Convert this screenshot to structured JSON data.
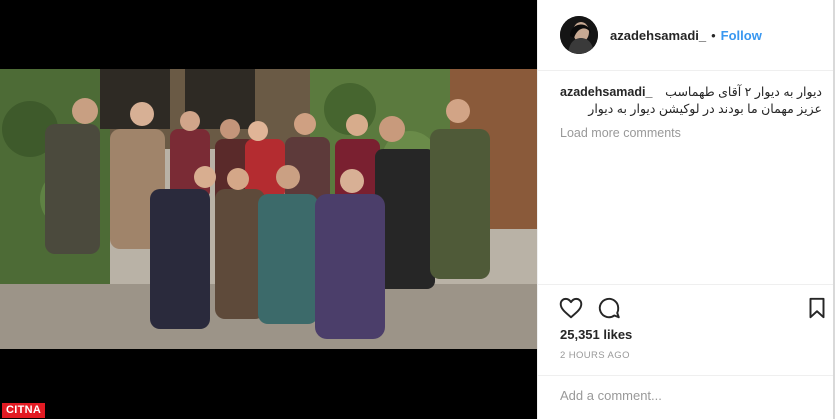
{
  "header": {
    "username": "azadehsamadi_",
    "separator": "•",
    "follow_label": "Follow",
    "avatar_icon": "profile-avatar"
  },
  "caption": {
    "username": "azadehsamadi_",
    "line1": "دیوار به دیوار ۲ آقای طهماسب",
    "line2": "عزیز مهمان ما بودند در لوکیشن دیوار به دیوار"
  },
  "comments": {
    "load_more_label": "Load more comments"
  },
  "actions": {
    "like_icon": "heart-icon",
    "comment_icon": "comment-bubble-icon",
    "save_icon": "bookmark-icon"
  },
  "stats": {
    "likes": "25,351 likes",
    "time": "2 HOURS AGO"
  },
  "comment_box": {
    "placeholder": "Add a comment..."
  },
  "watermark": {
    "text": "CITNA"
  },
  "colors": {
    "accent": "#3897f0",
    "muted": "#999999",
    "text": "#262626",
    "border": "#efefef",
    "watermark_bg": "#e31b23"
  }
}
